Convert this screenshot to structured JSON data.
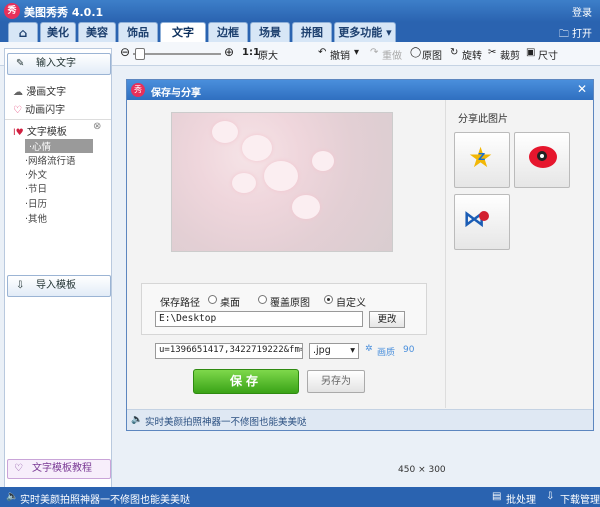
{
  "app": {
    "title": "美图秀秀 4.0.1",
    "logo": "秀",
    "login": "登录",
    "open": "打开"
  },
  "menu": {
    "tabs": [
      "美化",
      "美容",
      "饰品",
      "文字",
      "边框",
      "场景",
      "拼图",
      "更多功能"
    ],
    "active": "文字"
  },
  "toolbar": {
    "zoom_label": "1:1",
    "original_size": "原大",
    "undo": "撤销",
    "redo": "重做",
    "original": "原图",
    "rotate": "旋转",
    "crop": "裁剪",
    "resize": "尺寸"
  },
  "sidebar": {
    "input_text": "输入文字",
    "comic_text": "漫画文字",
    "animated_text": "动画闪字",
    "template_title": "文字模板",
    "templates": [
      "心情",
      "网络流行语",
      "外文",
      "节日",
      "日历",
      "其他"
    ],
    "import_template": "导入模板",
    "tutorial": "文字模板教程"
  },
  "dialog": {
    "logo": "秀",
    "title": "保存与分享",
    "close": "✕",
    "save_path_label": "保存路径",
    "options": [
      "桌面",
      "覆盖原图",
      "自定义"
    ],
    "selected_option": "自定义",
    "path_value": "E:\\Desktop",
    "change_label": "更改",
    "filename_value": "u=1396651417,3422719222&fm=20",
    "format_value": ".jpg",
    "quality_label": "画质",
    "quality_value": "90",
    "save_label": "保存",
    "save_as_label": "另存为",
    "footer_text": "实时美颜拍照神器一不修图也能美美哒",
    "share_title": "分享此图片"
  },
  "canvas": {
    "width": "450",
    "height": "300",
    "sep": "×"
  },
  "status": {
    "text": "实时美颜拍照神器一不修图也能美美哒",
    "batch": "批处理",
    "download": "下载管理"
  },
  "colors": {
    "accent": "#2a63b0",
    "save_green": "#3aa317"
  }
}
